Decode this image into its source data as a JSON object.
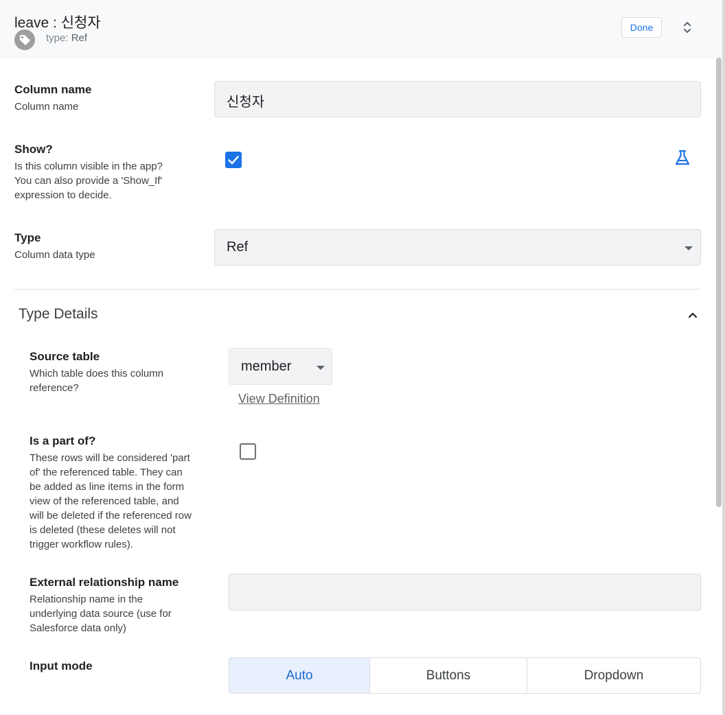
{
  "header": {
    "title": "leave : 신청자",
    "type_label": "type:",
    "type_value": "Ref",
    "done_label": "Done"
  },
  "column_name": {
    "label": "Column name",
    "description": "Column name",
    "value": "신청자"
  },
  "show": {
    "label": "Show?",
    "description_lines": [
      "Is this column visible in the app?",
      "You can also provide a 'Show_If'",
      "expression to decide."
    ],
    "checked": true
  },
  "type": {
    "label": "Type",
    "description": "Column data type",
    "value": "Ref"
  },
  "type_details": {
    "title": "Type Details",
    "source_table": {
      "label": "Source table",
      "description_lines": [
        "Which table does this column",
        "reference?"
      ],
      "value": "member",
      "link": "View Definition"
    },
    "part_of": {
      "label": "Is a part of?",
      "description_lines": [
        "These rows will be considered 'part",
        "of' the referenced table. They can",
        "be added as line items in the form",
        "view of the referenced table, and",
        "will be deleted if the referenced row",
        "is deleted (these deletes will not",
        "trigger workflow rules)."
      ],
      "checked": false
    },
    "external_relationship": {
      "label": "External relationship name",
      "description_lines": [
        "Relationship name in the",
        "underlying data source (use for",
        "Salesforce data only)"
      ],
      "value": ""
    },
    "input_mode": {
      "label": "Input mode",
      "options": [
        "Auto",
        "Buttons",
        "Dropdown"
      ],
      "selected": "Auto"
    }
  },
  "colors": {
    "accent": "#1a73e8",
    "field_bg": "#f1f3f4",
    "header_bg": "#f8f9fa",
    "active_segment_bg": "#e8f0fe"
  }
}
